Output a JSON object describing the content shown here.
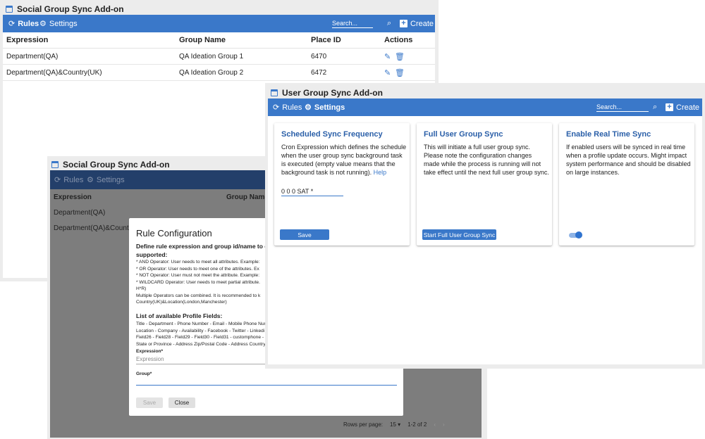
{
  "colors": {
    "accent": "#3a78c9",
    "accent_dark": "#233f6a",
    "link": "#2a5fa8"
  },
  "social_window": {
    "title": "Social Group Sync Add-on",
    "toolbar": {
      "rules_label": "Rules",
      "settings_label": "Settings",
      "search_placeholder": "Search...",
      "create_label": "Create"
    },
    "table": {
      "headers": [
        "Expression",
        "Group Name",
        "Place ID",
        "Actions"
      ],
      "rows": [
        {
          "expression": "Department(QA)",
          "group": "QA Ideation Group 1",
          "place_id": "6470"
        },
        {
          "expression": "Department(QA)&Country(UK)",
          "group": "QA Ideation Group 2",
          "place_id": "6472"
        }
      ]
    }
  },
  "modal_window": {
    "title": "Social Group Sync Add-on",
    "toolbar": {
      "rules_label": "Rules",
      "settings_label": "Settings"
    },
    "table": {
      "headers": [
        "Expression",
        "Group Name"
      ],
      "rows": [
        {
          "expression": "Department(QA)"
        },
        {
          "expression": "Department(QA)&Country(UK)"
        }
      ]
    },
    "modal": {
      "title": "Rule Configuration",
      "intro": "Define rule expression and group id/name to create a",
      "intro2": "supported:",
      "operators": [
        "* AND Operator: User needs to meet all attributes. Example:",
        "* OR Operator: User needs to meet one of the attributes. Ex",
        "* NOT Operator: User must not meet the attribute. Example:",
        "* WILDCARD Operator: User needs to meet partial attribute.",
        "H*R)",
        "Multiple Operators can be combined. It is recommended to k",
        "Country(UK)&Location(London,Manchester)"
      ],
      "profile_fields_title": "List of available Profile Fields:",
      "profile_fields": [
        "Title - Department - Phone Number - Email - Mobile Phone Nur",
        "Location - Company - Availability - Facebook - Twitter - Linkedi",
        "Field26 - Field28 - Field29 - Field30 - Field31 - customphone -",
        "State or Province - Address Zip/Postal Code - Address Country"
      ],
      "expression_label": "Expression*",
      "expression_placeholder": "Expression",
      "group_label": "Group*",
      "save_label": "Save",
      "close_label": "Close"
    },
    "pager": {
      "rows_label": "Rows per page:",
      "rows_value": "15",
      "range": "1-2 of 2"
    }
  },
  "user_window": {
    "title": "User Group Sync Add-on",
    "toolbar": {
      "rules_label": "Rules",
      "settings_label": "Settings",
      "search_placeholder": "Search...",
      "create_label": "Create"
    },
    "cards": {
      "schedule": {
        "title": "Scheduled Sync Frequency",
        "desc": "Cron Expression which defines the schedule when the user group sync background task is executed (empty value means that the background task is not running).",
        "help": "Help",
        "value": "0 0 0 SAT *",
        "button": "Save"
      },
      "full_sync": {
        "title": "Full User Group Sync",
        "desc": "This will initiate a full user group sync. Please note the configuration changes made while the process is running will not take effect until the next full user group sync.",
        "button": "Start Full User Group Sync"
      },
      "realtime": {
        "title": "Enable Real Time Sync",
        "desc": "If enabled users will be synced in real time when a profile update occurs. Might impact system performance and should be disabled on large instances.",
        "enabled": true
      }
    }
  }
}
